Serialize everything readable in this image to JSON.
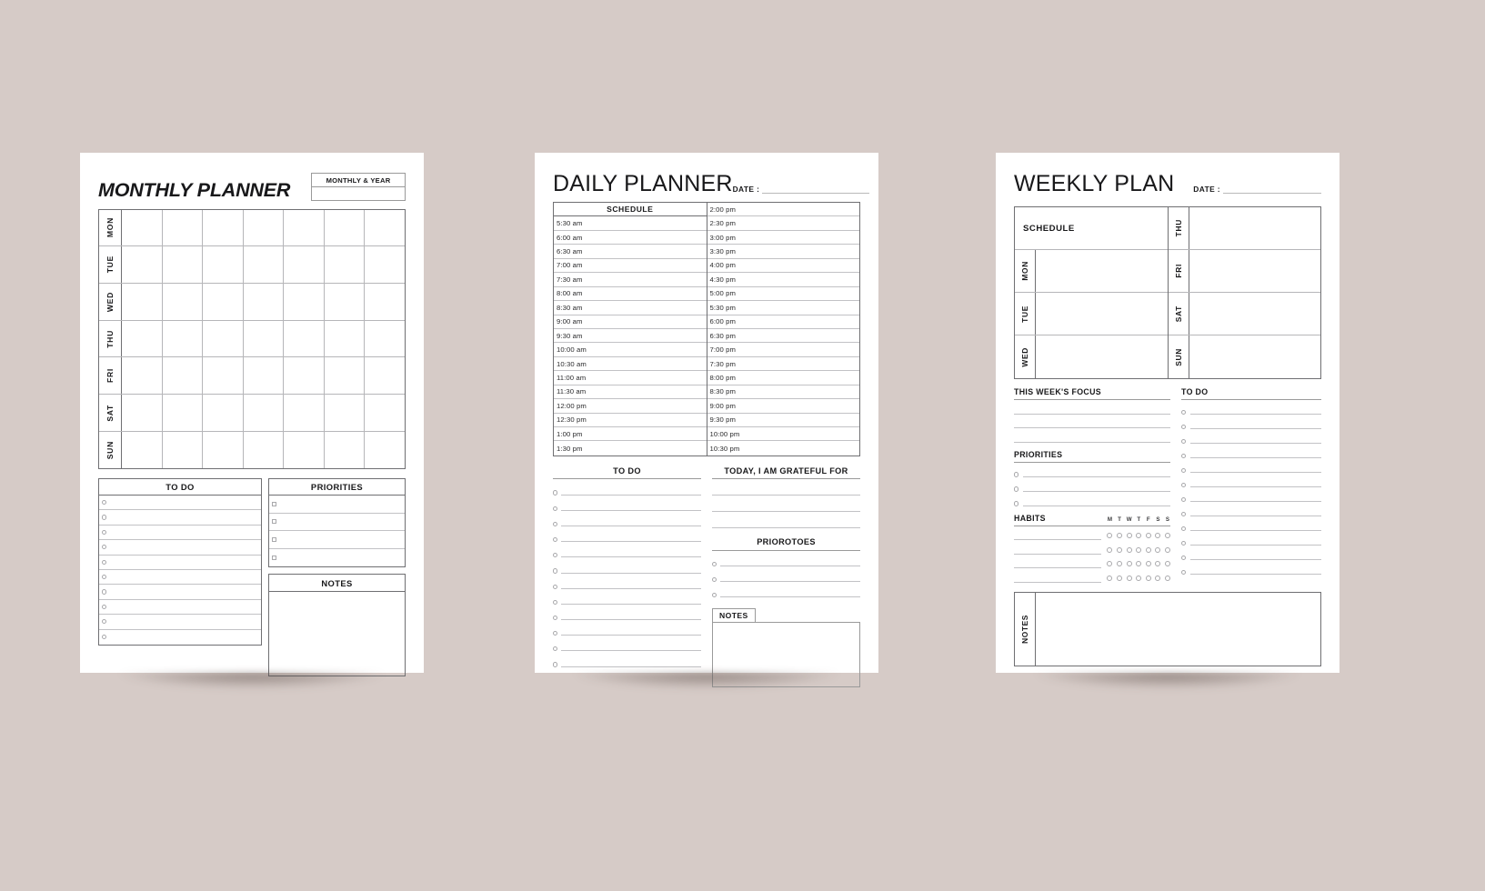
{
  "page": {
    "background_color": "#d6cbc7",
    "sheet_color": "#ffffff"
  },
  "monthly": {
    "title": "MONTHLY PLANNER",
    "month_year_label": "MONTHLY & YEAR",
    "days": [
      "MON",
      "TUE",
      "WED",
      "THU",
      "FRI",
      "SAT",
      "SUN"
    ],
    "calendar_columns": 7,
    "todo": {
      "heading": "TO DO",
      "rows": 10,
      "bullet": "circle"
    },
    "priorities": {
      "heading": "PRIORITIES",
      "rows": 4,
      "bullet": "square"
    },
    "notes": {
      "heading": "NOTES"
    }
  },
  "daily": {
    "title": "DAILY PLANNER",
    "date_label": "DATE :",
    "schedule_heading": "SCHEDULE",
    "times_left": [
      "5:30 am",
      "6:00 am",
      "6:30 am",
      "7:00 am",
      "7:30 am",
      "8:00 am",
      "8:30 am",
      "9:00 am",
      "9:30 am",
      "10:00 am",
      "10:30 am",
      "11:00 am",
      "11:30 am",
      "12:00 pm",
      "12:30 pm",
      "1:00 pm",
      "1:30 pm"
    ],
    "times_right": [
      "2:00 pm",
      "2:30 pm",
      "3:00 pm",
      "3:30 pm",
      "4:00 pm",
      "4:30 pm",
      "5:00 pm",
      "5:30 pm",
      "6:00 pm",
      "6:30 pm",
      "7:00 pm",
      "7:30 pm",
      "8:00 pm",
      "8:30 pm",
      "9:00 pm",
      "9:30 pm",
      "10:00 pm",
      "10:30 pm"
    ],
    "todo": {
      "heading": "TO DO",
      "rows": 12,
      "bullet": "circle"
    },
    "grateful": {
      "heading": "TODAY, I AM GRATEFUL FOR",
      "rows": 3
    },
    "priorotoes": {
      "heading": "PRIOROTOES",
      "rows": 3,
      "bullet": "circle"
    },
    "notes": {
      "heading": "NOTES"
    }
  },
  "weekly": {
    "title": "WEEKLY PLAN",
    "date_label": "DATE :",
    "schedule_heading": "SCHEDULE",
    "days_left": [
      "MON",
      "TUE",
      "WED"
    ],
    "days_right": [
      "THU",
      "FRI",
      "SAT",
      "SUN"
    ],
    "focus": {
      "heading": "THIS WEEK'S FOCUS",
      "rows": 3
    },
    "priorities": {
      "heading": "PRIORITIES",
      "rows": 3,
      "bullet": "circle"
    },
    "habits": {
      "heading": "HABITS",
      "day_initials": [
        "M",
        "T",
        "W",
        "T",
        "F",
        "S",
        "S"
      ],
      "rows": 4
    },
    "todo": {
      "heading": "TO DO",
      "rows": 12,
      "bullet": "circle"
    },
    "notes": {
      "heading": "NOTES"
    }
  }
}
